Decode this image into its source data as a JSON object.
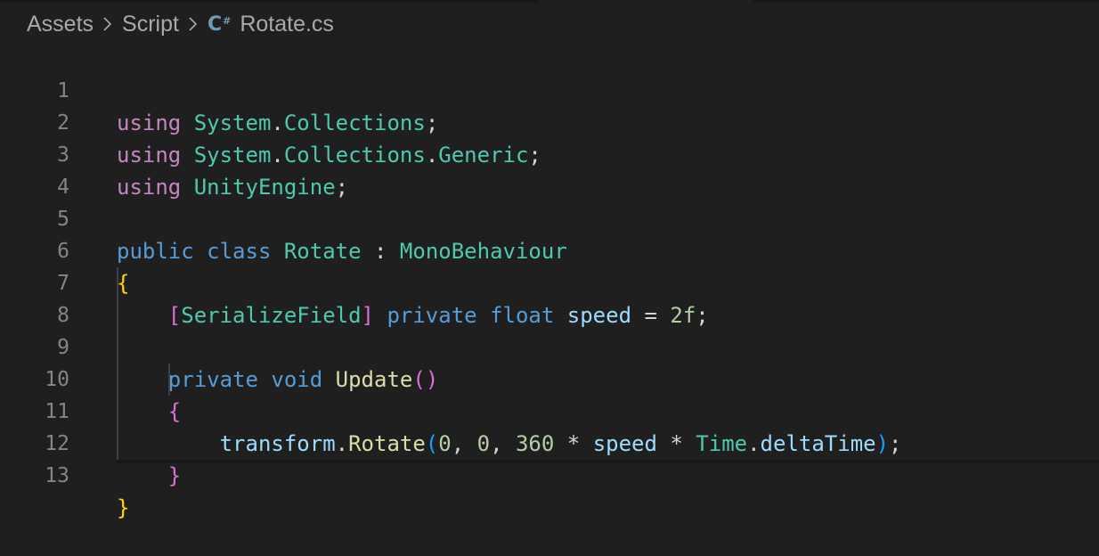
{
  "breadcrumb": {
    "items": [
      "Assets",
      "Script"
    ],
    "file_icon": "csharp-icon",
    "file_name": "Rotate.cs"
  },
  "editor": {
    "language": "C#",
    "line_numbers": [
      "1",
      "2",
      "3",
      "4",
      "5",
      "6",
      "7",
      "8",
      "9",
      "10",
      "11",
      "12",
      "13"
    ],
    "tokens": {
      "l1": [
        "using",
        "System",
        ".",
        "Collections",
        ";"
      ],
      "l2": [
        "using",
        "System",
        ".",
        "Collections",
        ".",
        "Generic",
        ";"
      ],
      "l3": [
        "using",
        "UnityEngine",
        ";"
      ],
      "l5": [
        "public",
        "class",
        "Rotate",
        ":",
        "MonoBehaviour"
      ],
      "l6": [
        "{"
      ],
      "l7": [
        "[",
        "SerializeField",
        "]",
        "private",
        "float",
        "speed",
        "=",
        "2f",
        ";"
      ],
      "l9": [
        "private",
        "void",
        "Update",
        "(",
        ")"
      ],
      "l10": [
        "{"
      ],
      "l11": [
        "transform",
        ".",
        "Rotate",
        "(",
        "0",
        ",",
        "0",
        ",",
        "360",
        "*",
        "speed",
        "*",
        "Time",
        ".",
        "deltaTime",
        ")",
        ";"
      ],
      "l12": [
        "}"
      ],
      "l13": [
        "}"
      ]
    }
  },
  "colors": {
    "background": "#1f1f1f",
    "keyword_control": "#c586c0",
    "keyword": "#569cd6",
    "type": "#4ec9b0",
    "variable": "#9cdcfe",
    "number": "#b5cea8",
    "function": "#dcdcaa",
    "line_number": "#858585",
    "bracket_level1": "#ffd700",
    "bracket_level2": "#da70d6",
    "bracket_level3": "#179fff"
  }
}
